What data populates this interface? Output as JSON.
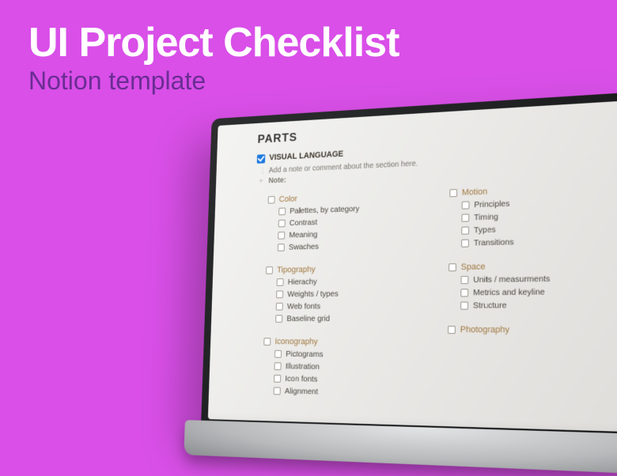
{
  "hero": {
    "title": "UI Project Checklist",
    "subtitle": "Notion template"
  },
  "page": {
    "title": "PARTS",
    "section": {
      "label": "VISUAL LANGUAGE",
      "checked": true,
      "note_placeholder": "Add a note or comment about the section here.",
      "note_label": "Note:"
    },
    "left": [
      {
        "heading": "Color",
        "items": [
          "Palettes, by category",
          "Contrast",
          "Meaning",
          "Swaches"
        ]
      },
      {
        "heading": "Tipography",
        "items": [
          "Hierachy",
          "Weights / types",
          "Web fonts",
          "Baseline grid"
        ]
      },
      {
        "heading": "Iconography",
        "items": [
          "Pictograms",
          "Illustration",
          "Icon fonts",
          "Alignment"
        ]
      }
    ],
    "right": [
      {
        "heading": "Motion",
        "items": [
          "Principles",
          "Timing",
          "Types",
          "Transitions"
        ]
      },
      {
        "heading": "Space",
        "items": [
          "Units / measurments",
          "Metrics and keyline",
          "Structure"
        ]
      },
      {
        "heading": "Photography",
        "items": []
      }
    ]
  }
}
